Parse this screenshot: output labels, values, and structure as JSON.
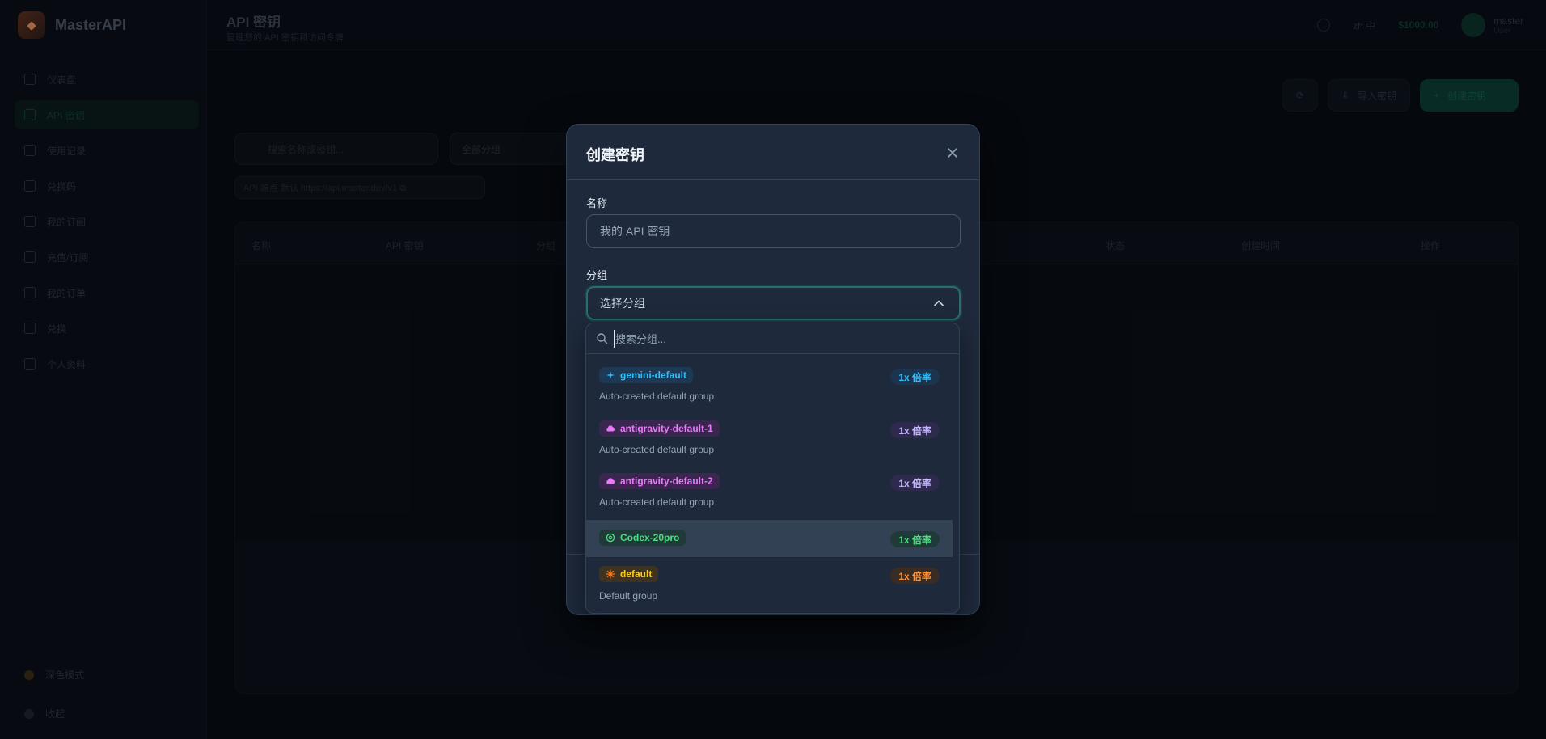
{
  "app": {
    "brand": "MasterAPI"
  },
  "topbar": {
    "title": "API 密钥",
    "subtitle": "管理您的 API 密钥和访问令牌",
    "lang": "zh 中",
    "balance": "$1000.00",
    "user_name": "master",
    "user_role": "User"
  },
  "sidebar": {
    "items": [
      {
        "label": "仪表盘"
      },
      {
        "label": "API 密钥"
      },
      {
        "label": "使用记录"
      },
      {
        "label": "兑换码"
      },
      {
        "label": "我的订阅"
      },
      {
        "label": "充值/订阅"
      },
      {
        "label": "我的订单"
      },
      {
        "label": "兑换"
      },
      {
        "label": "个人资料"
      }
    ],
    "bottom": [
      {
        "label": "深色模式"
      },
      {
        "label": "收起"
      }
    ]
  },
  "page": {
    "actions": {
      "refresh": "",
      "import": "导入密钥",
      "create": "创建密钥"
    },
    "search_placeholder": "搜索名称或密钥...",
    "group_filter": "全部分组",
    "chip": "API 端点  默认  https://api.master.dev/v1  ⧉",
    "columns": [
      "名称",
      "API 密钥",
      "分组",
      "状态",
      "创建时间",
      "操作"
    ]
  },
  "modal": {
    "title": "创建密钥",
    "name_label": "名称",
    "name_placeholder": "我的 API 密钥",
    "group_label": "分组",
    "group_placeholder": "选择分组",
    "search_placeholder": "搜索分组...",
    "options": [
      {
        "name": "gemini-default",
        "desc": "Auto-created default group",
        "rate": "1x 倍率",
        "icon": "sparkle-icon",
        "color": "#38bdf8",
        "bg": "#1c3a55",
        "rate_bg": "#1b3550"
      },
      {
        "name": "antigravity-default-1",
        "desc": "Auto-created default group",
        "rate": "1x 倍率",
        "icon": "cloud-icon",
        "color": "#e879f9",
        "bg": "#3b2650",
        "rate_bg": "#2e2a4d"
      },
      {
        "name": "antigravity-default-2",
        "desc": "Auto-created default group",
        "rate": "1x 倍率",
        "icon": "cloud-icon",
        "color": "#e879f9",
        "bg": "#3b2650",
        "rate_bg": "#2e2a4d"
      },
      {
        "name": "Codex-20pro",
        "desc": "",
        "rate": "1x 倍率",
        "icon": "openai-icon",
        "color": "#4ade80",
        "bg": "#1f3a38",
        "rate_bg": "#1e3b38"
      },
      {
        "name": "default",
        "desc": "Default group",
        "rate": "1x 倍率",
        "icon": "sun-icon",
        "color": "#facc15",
        "bg": "#3d3320",
        "rate_bg": "#3a2c22"
      }
    ]
  }
}
